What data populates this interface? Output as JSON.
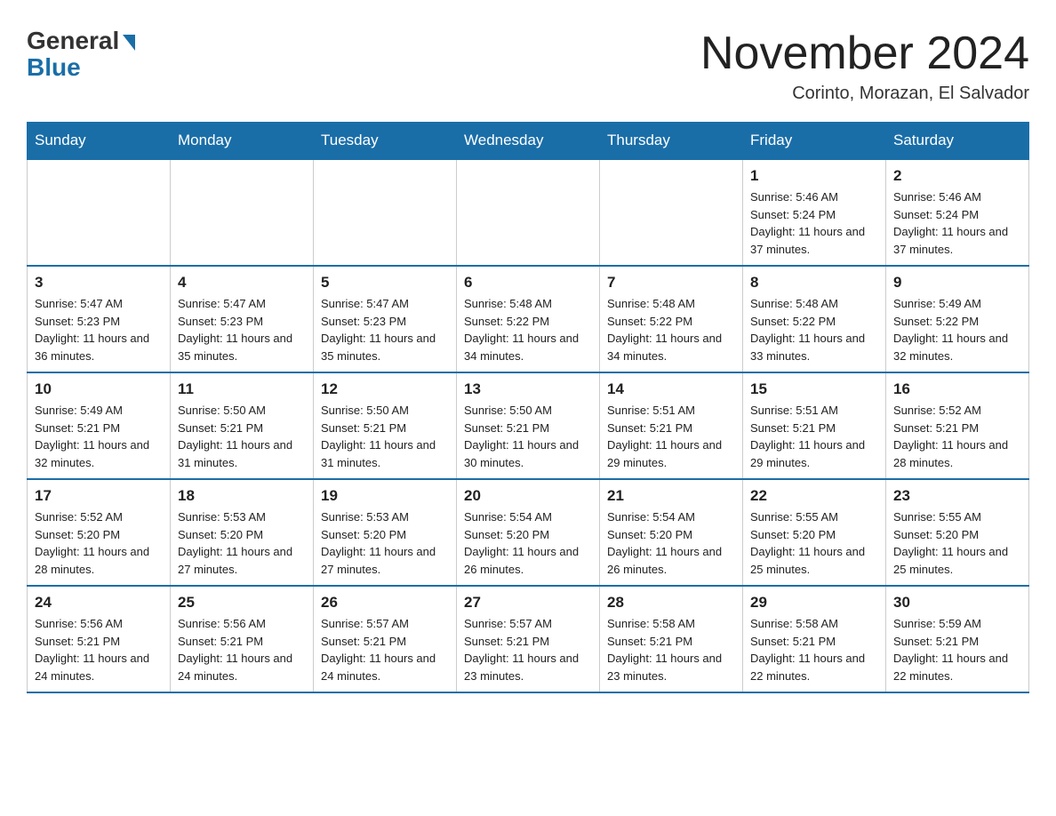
{
  "header": {
    "logo_general": "General",
    "logo_blue": "Blue",
    "month_title": "November 2024",
    "location": "Corinto, Morazan, El Salvador"
  },
  "calendar": {
    "days_of_week": [
      "Sunday",
      "Monday",
      "Tuesday",
      "Wednesday",
      "Thursday",
      "Friday",
      "Saturday"
    ],
    "weeks": [
      [
        {
          "day": "",
          "info": ""
        },
        {
          "day": "",
          "info": ""
        },
        {
          "day": "",
          "info": ""
        },
        {
          "day": "",
          "info": ""
        },
        {
          "day": "",
          "info": ""
        },
        {
          "day": "1",
          "info": "Sunrise: 5:46 AM\nSunset: 5:24 PM\nDaylight: 11 hours and 37 minutes."
        },
        {
          "day": "2",
          "info": "Sunrise: 5:46 AM\nSunset: 5:24 PM\nDaylight: 11 hours and 37 minutes."
        }
      ],
      [
        {
          "day": "3",
          "info": "Sunrise: 5:47 AM\nSunset: 5:23 PM\nDaylight: 11 hours and 36 minutes."
        },
        {
          "day": "4",
          "info": "Sunrise: 5:47 AM\nSunset: 5:23 PM\nDaylight: 11 hours and 35 minutes."
        },
        {
          "day": "5",
          "info": "Sunrise: 5:47 AM\nSunset: 5:23 PM\nDaylight: 11 hours and 35 minutes."
        },
        {
          "day": "6",
          "info": "Sunrise: 5:48 AM\nSunset: 5:22 PM\nDaylight: 11 hours and 34 minutes."
        },
        {
          "day": "7",
          "info": "Sunrise: 5:48 AM\nSunset: 5:22 PM\nDaylight: 11 hours and 34 minutes."
        },
        {
          "day": "8",
          "info": "Sunrise: 5:48 AM\nSunset: 5:22 PM\nDaylight: 11 hours and 33 minutes."
        },
        {
          "day": "9",
          "info": "Sunrise: 5:49 AM\nSunset: 5:22 PM\nDaylight: 11 hours and 32 minutes."
        }
      ],
      [
        {
          "day": "10",
          "info": "Sunrise: 5:49 AM\nSunset: 5:21 PM\nDaylight: 11 hours and 32 minutes."
        },
        {
          "day": "11",
          "info": "Sunrise: 5:50 AM\nSunset: 5:21 PM\nDaylight: 11 hours and 31 minutes."
        },
        {
          "day": "12",
          "info": "Sunrise: 5:50 AM\nSunset: 5:21 PM\nDaylight: 11 hours and 31 minutes."
        },
        {
          "day": "13",
          "info": "Sunrise: 5:50 AM\nSunset: 5:21 PM\nDaylight: 11 hours and 30 minutes."
        },
        {
          "day": "14",
          "info": "Sunrise: 5:51 AM\nSunset: 5:21 PM\nDaylight: 11 hours and 29 minutes."
        },
        {
          "day": "15",
          "info": "Sunrise: 5:51 AM\nSunset: 5:21 PM\nDaylight: 11 hours and 29 minutes."
        },
        {
          "day": "16",
          "info": "Sunrise: 5:52 AM\nSunset: 5:21 PM\nDaylight: 11 hours and 28 minutes."
        }
      ],
      [
        {
          "day": "17",
          "info": "Sunrise: 5:52 AM\nSunset: 5:20 PM\nDaylight: 11 hours and 28 minutes."
        },
        {
          "day": "18",
          "info": "Sunrise: 5:53 AM\nSunset: 5:20 PM\nDaylight: 11 hours and 27 minutes."
        },
        {
          "day": "19",
          "info": "Sunrise: 5:53 AM\nSunset: 5:20 PM\nDaylight: 11 hours and 27 minutes."
        },
        {
          "day": "20",
          "info": "Sunrise: 5:54 AM\nSunset: 5:20 PM\nDaylight: 11 hours and 26 minutes."
        },
        {
          "day": "21",
          "info": "Sunrise: 5:54 AM\nSunset: 5:20 PM\nDaylight: 11 hours and 26 minutes."
        },
        {
          "day": "22",
          "info": "Sunrise: 5:55 AM\nSunset: 5:20 PM\nDaylight: 11 hours and 25 minutes."
        },
        {
          "day": "23",
          "info": "Sunrise: 5:55 AM\nSunset: 5:20 PM\nDaylight: 11 hours and 25 minutes."
        }
      ],
      [
        {
          "day": "24",
          "info": "Sunrise: 5:56 AM\nSunset: 5:21 PM\nDaylight: 11 hours and 24 minutes."
        },
        {
          "day": "25",
          "info": "Sunrise: 5:56 AM\nSunset: 5:21 PM\nDaylight: 11 hours and 24 minutes."
        },
        {
          "day": "26",
          "info": "Sunrise: 5:57 AM\nSunset: 5:21 PM\nDaylight: 11 hours and 24 minutes."
        },
        {
          "day": "27",
          "info": "Sunrise: 5:57 AM\nSunset: 5:21 PM\nDaylight: 11 hours and 23 minutes."
        },
        {
          "day": "28",
          "info": "Sunrise: 5:58 AM\nSunset: 5:21 PM\nDaylight: 11 hours and 23 minutes."
        },
        {
          "day": "29",
          "info": "Sunrise: 5:58 AM\nSunset: 5:21 PM\nDaylight: 11 hours and 22 minutes."
        },
        {
          "day": "30",
          "info": "Sunrise: 5:59 AM\nSunset: 5:21 PM\nDaylight: 11 hours and 22 minutes."
        }
      ]
    ]
  }
}
